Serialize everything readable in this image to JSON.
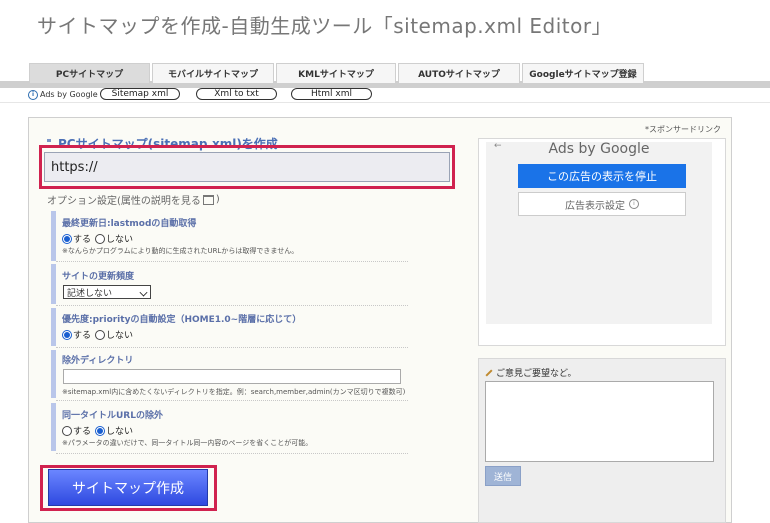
{
  "page_title": "サイトマップを作成-自動生成ツール「sitemap.xml Editor」",
  "tabs": [
    {
      "label": "PCサイトマップ",
      "active": true
    },
    {
      "label": "モバイルサイトマップ",
      "active": false
    },
    {
      "label": "KMLサイトマップ",
      "active": false
    },
    {
      "label": "AUTOサイトマップ",
      "active": false
    },
    {
      "label": "Googleサイトマップ登録",
      "active": false
    }
  ],
  "ad_links": {
    "ads_by": "Ads by Google",
    "items": [
      "Sitemap xml",
      "Xml to txt",
      "Html xml"
    ]
  },
  "main": {
    "section_title": "PCサイトマップ(sitemap.xml)を作成",
    "url_value": "https://",
    "option_heading": "オプション設定(属性の説明を見る",
    "option_heading_close": ")",
    "options": {
      "lastmod": {
        "label": "最終更新日:lastmodの自動取得",
        "yes": "する",
        "no": "しない",
        "note": "※なんらかプログラムにより動的に生成されたURLからは取得できません。"
      },
      "changefreq": {
        "label": "サイトの更新頻度",
        "selected": "記述しない"
      },
      "priority": {
        "label": "優先度:priorityの自動設定（HOME1.0~階層に応じて）",
        "yes": "する",
        "no": "しない"
      },
      "exclude": {
        "label": "除外ディレクトリ",
        "note": "※sitemap.xml内に含めたくないディレクトリを指定。例：search,member,admin(カンマ区切りで複数可)"
      },
      "duplicate": {
        "label": "同一タイトルURLの除外",
        "yes": "する",
        "no": "しない",
        "note": "※パラメータの違いだけで、同一タイトル同一内容のページを省くことが可能。"
      }
    },
    "submit_label": "サイトマップ作成"
  },
  "sidebar": {
    "sponsor_label": "*スポンサードリンク",
    "ad": {
      "back_arrow": "←",
      "ads_by": "Ads by Google",
      "stop_label": "この広告の表示を停止",
      "settings_label": "広告表示設定",
      "settings_icon": "i"
    },
    "feedback": {
      "title": "ご意見ご要望など。",
      "send_label": "送信"
    }
  },
  "colors": {
    "highlight": "#d0224f",
    "submit": "#2e49e0",
    "google_blue": "#1a73e8",
    "label_blue": "#5a6fa8"
  }
}
